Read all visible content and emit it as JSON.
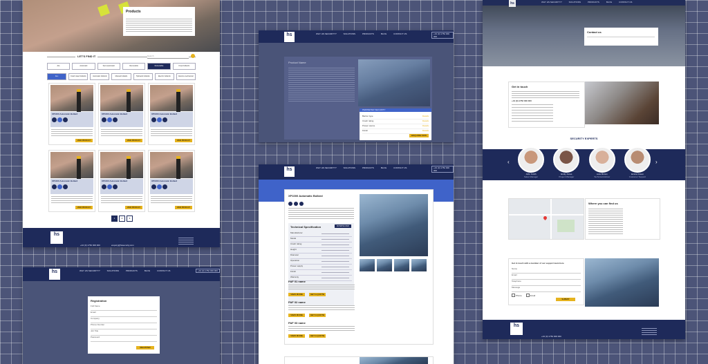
{
  "nav": {
    "items": [
      "WHY HS SECURITY?",
      "SOLUTIONS",
      "PRODUCTS",
      "BLOG",
      "CONTACT US"
    ],
    "cta": "+44 (0) 1752 000 000"
  },
  "products_page": {
    "hero_title": "Products",
    "find_label": "LET'S FIND IT",
    "search_placeholder": "Search",
    "filters_row1": [
      "ALL",
      "Automatic",
      "Semi-automatic",
      "Removable",
      "Retractable",
      "Fixed bollards"
    ],
    "filters_row2": [
      "ALL",
      "Crash rated bollards",
      "Automatic bollards",
      "Manual bollards",
      "Hydraulic bollards",
      "Electric bollards",
      "Electro-mechanical"
    ],
    "product_name": "XP1000 Automatic Bollard",
    "view_label": "VIEW PRODUCT",
    "pages": [
      "1",
      "2",
      "3"
    ],
    "footer_phone": "+44 (0) 1752 000 000",
    "footer_email": "enquiry@hssecurity.com"
  },
  "solutions_page": {
    "title": "Product Name",
    "panel_title": "PERIMETER SECURITY",
    "panel_rows": [
      "Barrier type",
      "Crash rating",
      "Power source",
      "Finish"
    ],
    "panel_values": [
      "Details",
      "Details",
      "Details",
      "Details"
    ],
    "panel_btn": "ENQUIRE NOW"
  },
  "product_detail": {
    "title": "XP1000 Automatic Bollard",
    "spec_title": "Technical Specification",
    "spec_btn": "DOWNLOAD",
    "spec_rows": [
      "Manufacturer",
      "Model",
      "Crash rating",
      "Height",
      "Diameter",
      "Operation",
      "Power supply",
      "Finish",
      "Warranty"
    ],
    "related": [
      "PAF 01 name",
      "PAF 02 name",
      "PAF 03 name"
    ],
    "related_btn": "VIEW MORE",
    "related_btn2": "GET A QUOTE"
  },
  "registration": {
    "title": "Registration",
    "fields": [
      "Full Name",
      "Email",
      "Company",
      "Phone Number",
      "Job Title",
      "Password"
    ],
    "submit": "REGISTER"
  },
  "contact_page": {
    "hero_card": "Contact us",
    "get_in_touch": "Get in touch",
    "phone": "+44 (0) 1752 000 000",
    "experts_title": "SECURITY EXPERTS",
    "experts": [
      {
        "name": "John Smith",
        "role": "Sales Manager"
      },
      {
        "name": "Emily Jones",
        "role": "Project Manager"
      },
      {
        "name": "Luke Brown",
        "role": "Technical Advisor"
      },
      {
        "name": "Emma Green",
        "role": "Customer Support"
      }
    ],
    "find_us": "Where you can find us",
    "form_title": "Get in touch with a member of our support team here",
    "form_fields": [
      "Name",
      "Email",
      "Telephone",
      "Message"
    ],
    "form_checks": [
      "Phone",
      "Email"
    ],
    "submit": "SUBMIT"
  },
  "colors": {
    "navy": "#1e2a5a",
    "accent": "#e6b31e",
    "background": "#4c5478"
  }
}
